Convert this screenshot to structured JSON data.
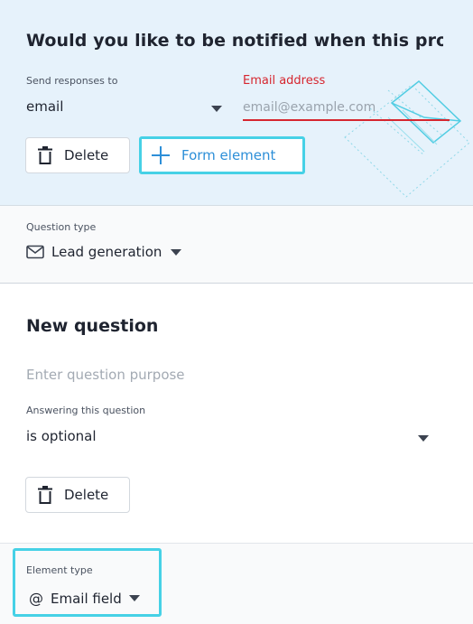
{
  "notify_card": {
    "title": "Would you like to be notified when this pro",
    "send_label": "Send responses to",
    "send_value": "email",
    "email_label": "Email address",
    "email_placeholder": "email@example.com",
    "email_value": "",
    "delete_label": "Delete",
    "form_element_label": "Form element"
  },
  "question_type": {
    "label": "Question type",
    "value": "Lead generation"
  },
  "new_question": {
    "title": "New question",
    "purpose_placeholder": "Enter question purpose",
    "answering_label": "Answering this question",
    "answering_value": "is optional",
    "delete_label": "Delete"
  },
  "element_type": {
    "label": "Element type",
    "icon": "@",
    "value": "Email field"
  },
  "colors": {
    "accent_cyan": "#46d1e6",
    "link_blue": "#2d8fd8",
    "error_red": "#d6262f",
    "notify_bg": "#e6f2fb"
  },
  "icons": {
    "delete": "trash-icon",
    "form_element": "plus-icon",
    "lead_generation": "mail-icon",
    "dropdown": "caret-down-icon",
    "email_field": "at-icon"
  }
}
